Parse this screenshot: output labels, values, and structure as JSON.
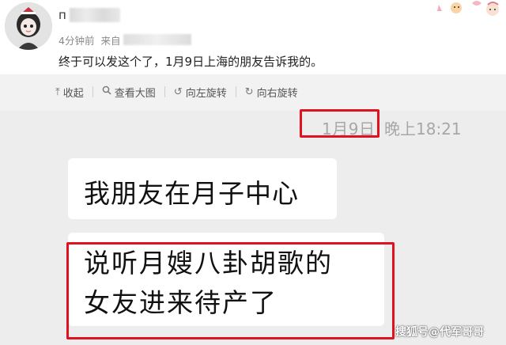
{
  "post": {
    "username_first_char": "п",
    "time_ago": "4分钟前",
    "source_prefix": "来自",
    "text": "终于可以发这个了，1月9日上海的朋友告诉我的。"
  },
  "toolbar": {
    "items": [
      {
        "icon": "collapse-icon",
        "glyph": "⤒",
        "label": "收起"
      },
      {
        "icon": "magnify-icon",
        "glyph": "🔍︎",
        "label": "查看大图"
      },
      {
        "icon": "rotate-left-icon",
        "glyph": "↺",
        "label": "向左旋转"
      },
      {
        "icon": "rotate-right-icon",
        "glyph": "↻",
        "label": "向右旋转"
      }
    ]
  },
  "chat": {
    "date": "1月9日",
    "time": "晚上18:21",
    "message1": "我朋友在月子中心",
    "message2_line1": "说听月嫂八卦胡歌的",
    "message2_line2": "女友进来待产了"
  },
  "watermark": "搜狐号@代军哥哥",
  "colors": {
    "highlight_border": "#e0121f",
    "toolbar_bg": "#f2f2f2",
    "chat_bg": "#ededed"
  }
}
